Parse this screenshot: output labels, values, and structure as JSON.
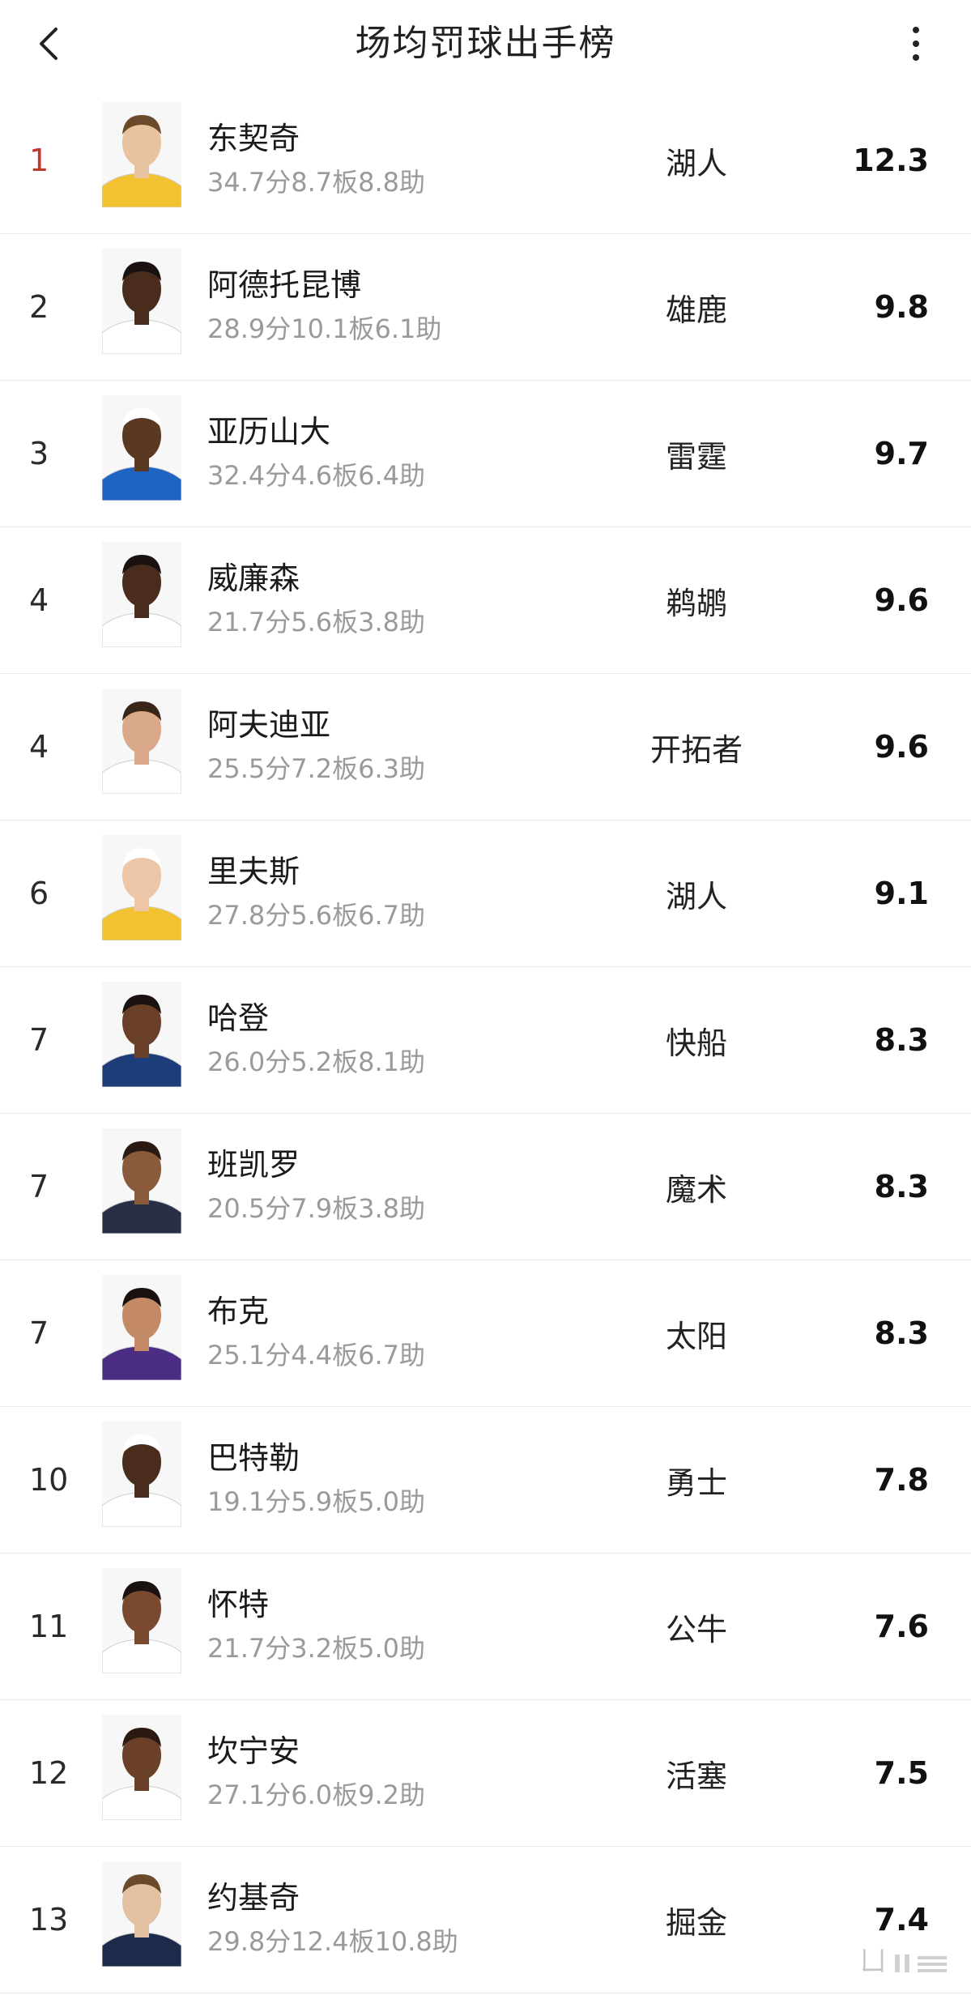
{
  "header": {
    "title": "场均罚球出手榜"
  },
  "colors": {
    "rank_highlight": "#c0392b"
  },
  "players": [
    {
      "rank": "1",
      "name": "东契奇",
      "stats": "34.7分8.7板8.8助",
      "team": "湖人",
      "value": "12.3",
      "jersey": "#f2c230",
      "skin": "#e8c3a0",
      "hair": "#6b4a2c"
    },
    {
      "rank": "2",
      "name": "阿德托昆博",
      "stats": "28.9分10.1板6.1助",
      "team": "雄鹿",
      "value": "9.8",
      "jersey": "#ffffff",
      "skin": "#4a2c1c",
      "hair": "#1a1210"
    },
    {
      "rank": "3",
      "name": "亚历山大",
      "stats": "32.4分4.6板6.4助",
      "team": "雷霆",
      "value": "9.7",
      "jersey": "#1f63c4",
      "skin": "#5b3822",
      "hair": "#ffffff"
    },
    {
      "rank": "4",
      "name": "威廉森",
      "stats": "21.7分5.6板3.8助",
      "team": "鹈鹕",
      "value": "9.6",
      "jersey": "#ffffff",
      "skin": "#4a2c1c",
      "hair": "#1a1210"
    },
    {
      "rank": "4",
      "name": "阿夫迪亚",
      "stats": "25.5分7.2板6.3助",
      "team": "开拓者",
      "value": "9.6",
      "jersey": "#ffffff",
      "skin": "#d9a98a",
      "hair": "#3a2618"
    },
    {
      "rank": "6",
      "name": "里夫斯",
      "stats": "27.8分5.6板6.7助",
      "team": "湖人",
      "value": "9.1",
      "jersey": "#f2c230",
      "skin": "#ecc6a6",
      "hair": "#ffffff"
    },
    {
      "rank": "7",
      "name": "哈登",
      "stats": "26.0分5.2板8.1助",
      "team": "快船",
      "value": "8.3",
      "jersey": "#1d3d7a",
      "skin": "#6b4028",
      "hair": "#1a1210"
    },
    {
      "rank": "7",
      "name": "班凯罗",
      "stats": "20.5分7.9板3.8助",
      "team": "魔术",
      "value": "8.3",
      "jersey": "#2a2f45",
      "skin": "#8a5a3c",
      "hair": "#2a1a12"
    },
    {
      "rank": "7",
      "name": "布克",
      "stats": "25.1分4.4板6.7助",
      "team": "太阳",
      "value": "8.3",
      "jersey": "#4b2e83",
      "skin": "#c48a66",
      "hair": "#1a1210"
    },
    {
      "rank": "10",
      "name": "巴特勒",
      "stats": "19.1分5.9板5.0助",
      "team": "勇士",
      "value": "7.8",
      "jersey": "#ffffff",
      "skin": "#4a2c1c",
      "hair": "#ffffff"
    },
    {
      "rank": "11",
      "name": "怀特",
      "stats": "21.7分3.2板5.0助",
      "team": "公牛",
      "value": "7.6",
      "jersey": "#ffffff",
      "skin": "#7a4a30",
      "hair": "#1a1210"
    },
    {
      "rank": "12",
      "name": "坎宁安",
      "stats": "27.1分6.0板9.2助",
      "team": "活塞",
      "value": "7.5",
      "jersey": "#ffffff",
      "skin": "#6b4028",
      "hair": "#2a1a12"
    },
    {
      "rank": "13",
      "name": "约基奇",
      "stats": "29.8分12.4板10.8助",
      "team": "掘金",
      "value": "7.4",
      "jersey": "#1d2a4a",
      "skin": "#e4c0a2",
      "hair": "#6b4a2c"
    }
  ]
}
